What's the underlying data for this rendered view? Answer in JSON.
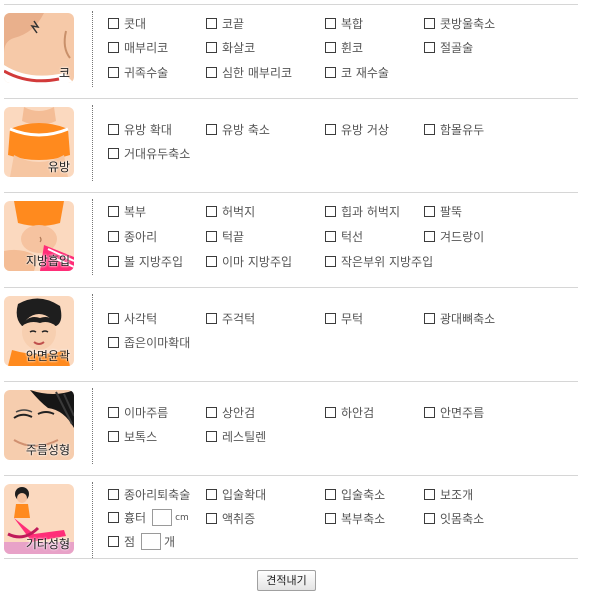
{
  "sections": [
    {
      "label": "코",
      "rows": [
        [
          "콧대",
          "코끝",
          "복합",
          "콧방울축소"
        ],
        [
          "매부리코",
          "화살코",
          "휜코",
          "절골술"
        ],
        [
          "귀족수술",
          "심한 매부리코",
          "코 재수술"
        ]
      ]
    },
    {
      "label": "유방",
      "rows": [
        [
          "유방 확대",
          "유방 축소",
          "유방 거상",
          "함몰유두"
        ],
        [
          "거대유두축소"
        ]
      ]
    },
    {
      "label": "지방흡입",
      "rows": [
        [
          "복부",
          "허벅지",
          "힙과 허벅지",
          "팔뚝"
        ],
        [
          "종아리",
          "턱끝",
          "턱선",
          "겨드랑이"
        ],
        [
          "볼 지방주입",
          "이마 지방주입",
          "작은부위 지방주입"
        ]
      ]
    },
    {
      "label": "안면윤곽",
      "rows": [
        [
          "사각턱",
          "주걱턱",
          "무턱",
          "광대뼈축소"
        ],
        [
          "좁은이마확대"
        ]
      ]
    },
    {
      "label": "주름성형",
      "rows": [
        [
          "이마주름",
          "상안검",
          "하안검",
          "안면주름"
        ],
        [
          "보톡스",
          "레스틸렌"
        ]
      ]
    },
    {
      "label": "기타성형",
      "rows": [
        [
          "종아리퇴축술",
          "입술확대",
          "입술축소",
          "보조개"
        ],
        [
          "흉터",
          "액취증",
          "복부축소",
          "잇몸축소"
        ],
        [
          "점"
        ]
      ],
      "scar_unit": "cm",
      "mole_unit": "개"
    }
  ],
  "submit_label": "견적내기",
  "colors": {
    "divider": "#d6d6d6",
    "thumb_bg": "#fbd5b5",
    "text": "#555555"
  }
}
